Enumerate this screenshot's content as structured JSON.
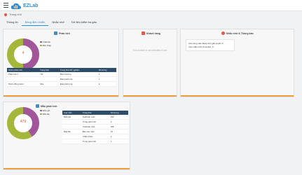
{
  "brand": {
    "name": "EZLab"
  },
  "breadcrumb": {
    "label": "Trang chủ"
  },
  "tabs": [
    "Thông tin",
    "Bảng điều khiển",
    "Nhắc nhở",
    "Dữ liệu kiểm tra gấu"
  ],
  "panels": {
    "analysis": {
      "title": "Phân tích",
      "center_value": "4",
      "legend": [
        "Xuất bản",
        "Bản nháp"
      ],
      "table": {
        "headers": [
          "Nhóm phân tích",
          "Trạng thái",
          "Trạng thái thử nghiệm",
          "Số lượng"
        ],
        "rows": [
          [
            "Phân tích 1",
            "Tốt",
            "Bình thường",
            "1"
          ],
          [
            "",
            "",
            "Đang kiểm tra",
            "1"
          ],
          [
            "Nhóm đông dược",
            "Nhẹ",
            "Đang kiểm tra",
            "2"
          ]
        ]
      },
      "chart": {
        "values": [
          2,
          2
        ],
        "colors": [
          "#a3559a",
          "#a5b63a"
        ]
      }
    },
    "customers": {
      "title": "Khách hàng",
      "message": "This module is not activated in use"
    },
    "reminders": {
      "title": "Nhắc nhở & Thông báo",
      "items": [
        "Các công việc đang chờ giải quyết: 0",
        "Các nhắc nhở chưa đọc: 0"
      ]
    },
    "sample": {
      "title": "Mẫu phân tích",
      "center_value": "479",
      "legend": [
        "Mẫu gửi",
        "Mẫu lấy"
      ],
      "table": {
        "headers": [
          "Loại mẫu",
          "Trạng thái",
          "Số lượng"
        ],
        "rows": [
          [
            "Mẫu gửi",
            "Xuất bản mẫu",
            "192"
          ],
          [
            "",
            "Trong quá trình",
            "3"
          ],
          [
            "",
            "Xuất bản mẫu",
            "268"
          ],
          [
            "Mẫu lấy",
            "Báo cáo mẫu",
            "13"
          ],
          [
            "",
            "Chấp thuận",
            "2"
          ],
          [
            "",
            "Trong quá trình",
            "1"
          ]
        ]
      },
      "chart": {
        "values": [
          195,
          284
        ],
        "colors": [
          "#a3559a",
          "#a5b63a"
        ]
      }
    }
  }
}
